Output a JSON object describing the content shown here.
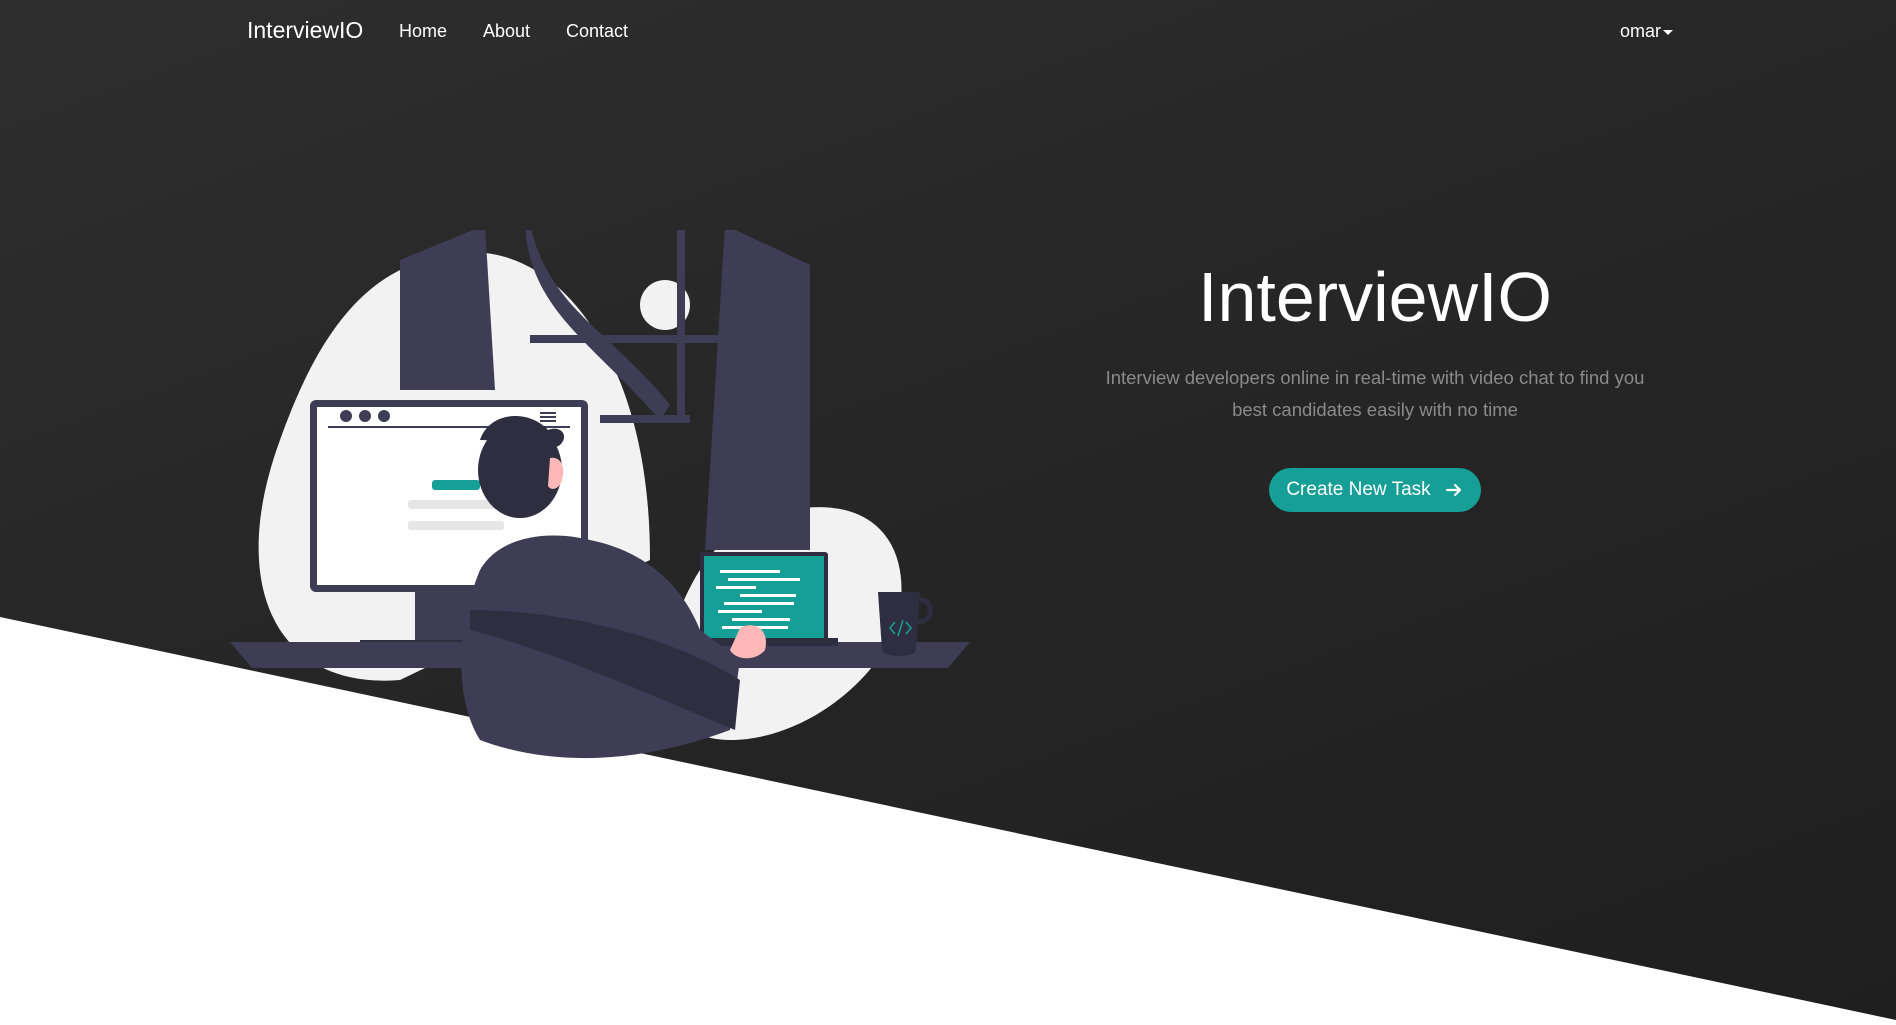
{
  "navbar": {
    "brand": "InterviewIO",
    "links": [
      {
        "label": "Home"
      },
      {
        "label": "About"
      },
      {
        "label": "Contact"
      }
    ],
    "user": {
      "name": "omar",
      "icon": "caret-down-icon"
    }
  },
  "hero": {
    "title": "InterviewIO",
    "subtitle_line1": "Interview developers online in real-time with video chat to find you",
    "subtitle_line2": "best candidates easily with no time",
    "cta": {
      "label": "Create New Task",
      "icon": "arrow-right-icon"
    }
  },
  "colors": {
    "accent": "#169f96",
    "hero_background": "#262626",
    "lower_background": "#ffffff",
    "subtitle_text": "#8a8a8a"
  },
  "illustration": {
    "icon": "developer-at-desk-illustration"
  }
}
